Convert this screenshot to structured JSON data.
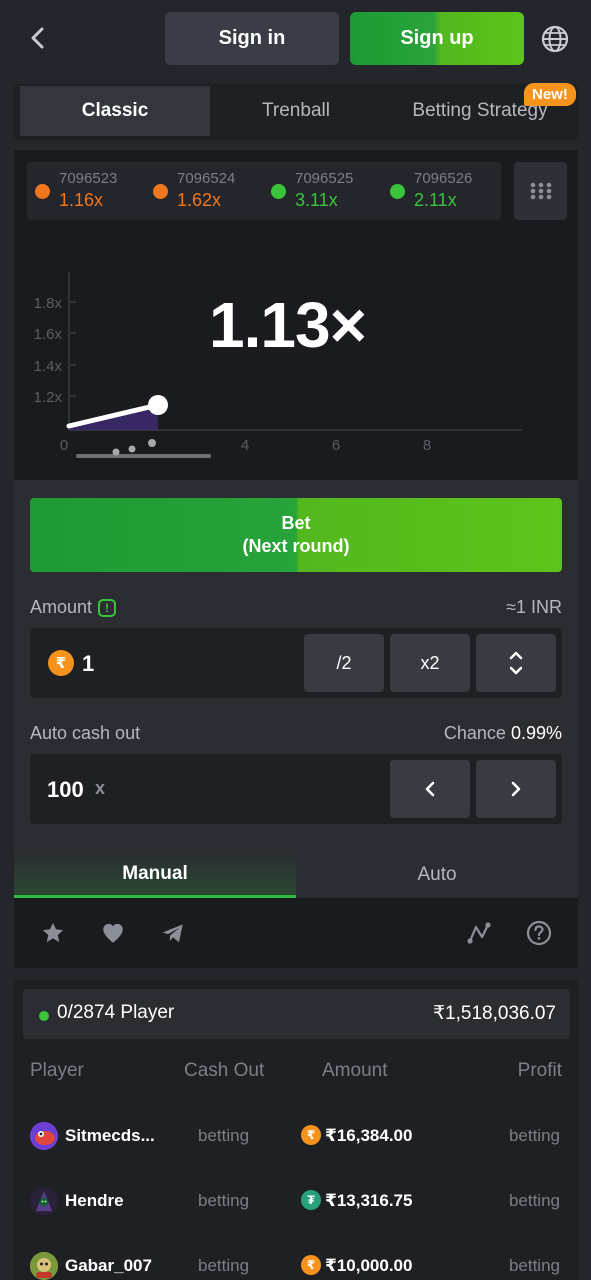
{
  "header": {
    "signin_label": "Sign in",
    "signup_label": "Sign up"
  },
  "mode_tabs": [
    {
      "label": "Classic",
      "active": true
    },
    {
      "label": "Trenball",
      "active": false
    },
    {
      "label": "Betting Strategy",
      "active": false
    }
  ],
  "new_badge": "New!",
  "history": [
    {
      "id": "7096523",
      "value": "1.16x",
      "color": "#f0771e"
    },
    {
      "id": "7096524",
      "value": "1.62x",
      "color": "#f0771e"
    },
    {
      "id": "7096525",
      "value": "3.11x",
      "color": "#3bc43b"
    },
    {
      "id": "7096526",
      "value": "2.11x",
      "color": "#3bc43b"
    }
  ],
  "game": {
    "multiplier": "1.13×",
    "y_ticks": [
      "1.8x",
      "1.6x",
      "1.4x",
      "1.2x"
    ],
    "x_ticks": [
      "0",
      "4",
      "6",
      "8"
    ]
  },
  "bet": {
    "button_line1": "Bet",
    "button_line2": "(Next round)",
    "amount_label": "Amount",
    "amount_info": "!",
    "amount_conversion": "≈1 INR",
    "amount_value": "1",
    "currency_symbol": "₹",
    "half_label": "/2",
    "double_label": "x2",
    "autocashout_label": "Auto cash out",
    "chance_label": "Chance",
    "chance_value": "0.99%",
    "autocashout_value": "100",
    "autocashout_suffix": "x"
  },
  "bet_tabs": [
    {
      "label": "Manual",
      "active": true
    },
    {
      "label": "Auto",
      "active": false
    }
  ],
  "players": {
    "count_text": "0/2874 Player",
    "total": "₹1,518,036.07",
    "columns": [
      "Player",
      "Cash Out",
      "Amount",
      "Profit"
    ],
    "rows": [
      {
        "name": "Sitmecds...",
        "cashout": "betting",
        "coin": "₹",
        "coin_color": "#f7931a",
        "amount": "₹16,384.00",
        "profit": "betting",
        "avatar_color": "#c23bd4"
      },
      {
        "name": "Hendre",
        "cashout": "betting",
        "coin": "₮",
        "coin_color": "#26a17b",
        "amount": "₹13,316.75",
        "profit": "betting",
        "avatar_color": "#2c2440"
      },
      {
        "name": "Gabar_007",
        "cashout": "betting",
        "coin": "₹",
        "coin_color": "#f7931a",
        "amount": "₹10,000.00",
        "profit": "betting",
        "avatar_color": "#8bb04a"
      }
    ]
  }
}
